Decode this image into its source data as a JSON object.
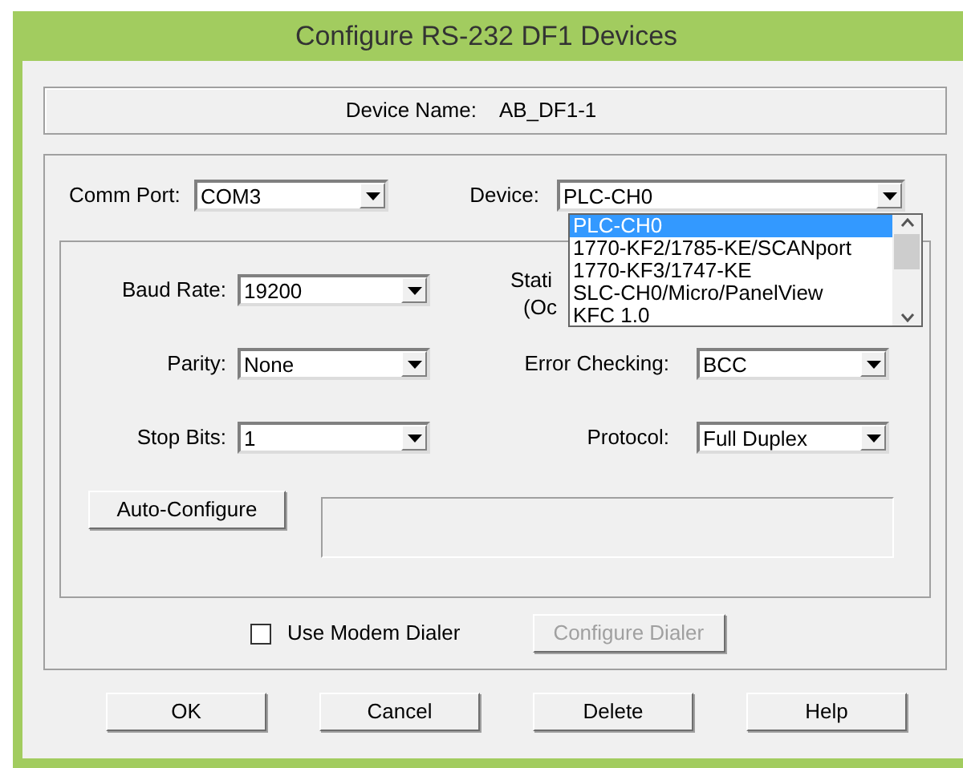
{
  "window": {
    "title": "Configure RS-232 DF1 Devices"
  },
  "device_name": {
    "label": "Device Name:",
    "value": "AB_DF1-1"
  },
  "comm_port": {
    "label": "Comm Port:",
    "value": "COM3"
  },
  "device": {
    "label": "Device:",
    "value": "PLC-CH0",
    "list": [
      {
        "text": "PLC-CH0",
        "selected": true
      },
      {
        "text": "1770-KF2/1785-KE/SCANport",
        "selected": false
      },
      {
        "text": "1770-KF3/1747-KE",
        "selected": false
      },
      {
        "text": "SLC-CH0/Micro/PanelView",
        "selected": false
      },
      {
        "text": "KFC 1.0",
        "selected": false
      }
    ]
  },
  "station_label": [
    "Stati",
    "(Oc"
  ],
  "rows": [
    {
      "left": {
        "label": "Baud Rate:",
        "value": "19200"
      }
    },
    {
      "left": {
        "label": "Parity:",
        "value": "None"
      },
      "right": {
        "label": "Error Checking:",
        "value": "BCC"
      }
    },
    {
      "left": {
        "label": "Stop Bits:",
        "value": "1"
      },
      "right": {
        "label": "Protocol:",
        "value": "Full Duplex"
      }
    }
  ],
  "auto_configure": {
    "label": "Auto-Configure"
  },
  "modem_dialer": {
    "label": "Use Modem Dialer",
    "checked": false
  },
  "configure_dialer": {
    "label": "Configure Dialer",
    "disabled": true
  },
  "buttons": [
    "OK",
    "Cancel",
    "Delete",
    "Help"
  ]
}
